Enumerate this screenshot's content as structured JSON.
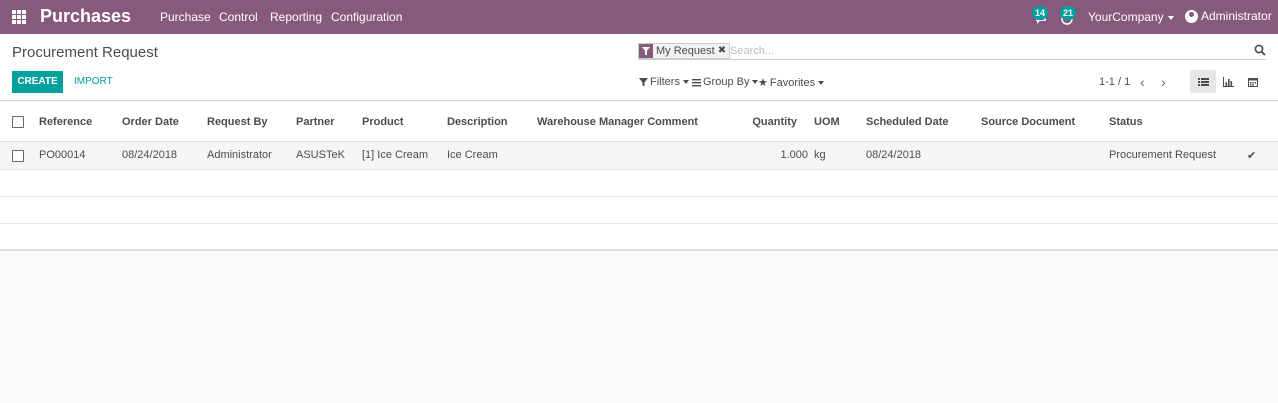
{
  "navbar": {
    "app_title": "Purchases",
    "menu": [
      "Purchase",
      "Control",
      "Reporting",
      "Configuration"
    ],
    "messages_count": "14",
    "activities_count": "21",
    "company": "YourCompany",
    "user": "Administrator"
  },
  "control_panel": {
    "title": "Procurement Request",
    "create_label": "CREATE",
    "import_label": "IMPORT",
    "search": {
      "facet": "My Request",
      "placeholder": "Search..."
    },
    "filters_label": "Filters",
    "groupby_label": "Group By",
    "favorites_label": "Favorites",
    "pager": "1-1 / 1"
  },
  "table": {
    "columns": {
      "reference": "Reference",
      "order_date": "Order Date",
      "request_by": "Request By",
      "partner": "Partner",
      "product": "Product",
      "description": "Description",
      "warehouse_comment": "Warehouse Manager Comment",
      "quantity": "Quantity",
      "uom": "UOM",
      "scheduled_date": "Scheduled Date",
      "source_document": "Source Document",
      "status": "Status"
    },
    "rows": [
      {
        "reference": "PO00014",
        "order_date": "08/24/2018",
        "request_by": "Administrator",
        "partner": "ASUSTeK",
        "product": "[1] Ice Cream",
        "description": "Ice Cream",
        "warehouse_comment": "",
        "quantity": "1.000",
        "uom": "kg",
        "scheduled_date": "08/24/2018",
        "source_document": "",
        "status": "Procurement Request"
      }
    ]
  },
  "colors": {
    "brand": "#875a7b",
    "accent": "#00a09d"
  }
}
